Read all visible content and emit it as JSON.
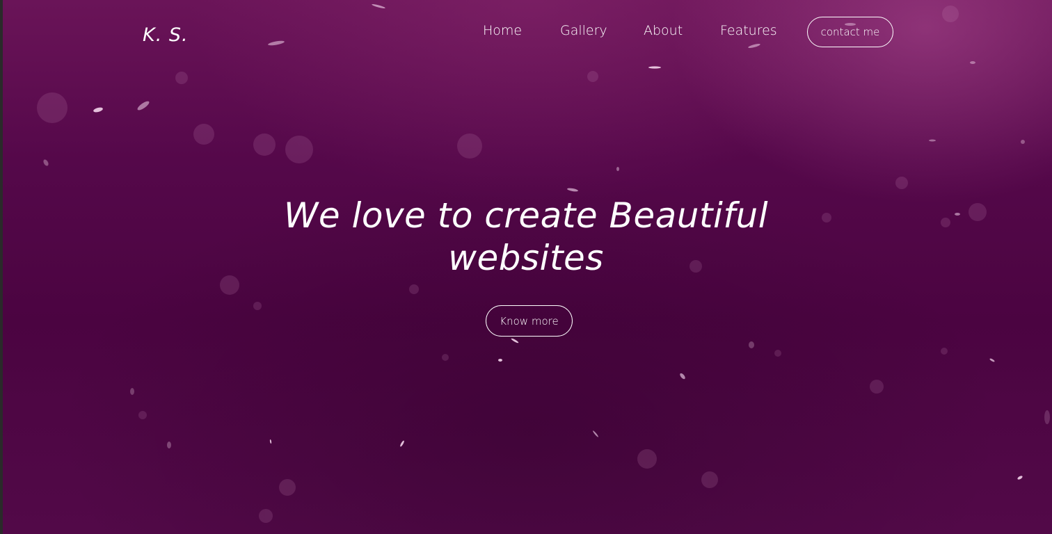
{
  "brand": {
    "logo": "K. S."
  },
  "nav": {
    "items": [
      {
        "label": "Home"
      },
      {
        "label": "Gallery"
      },
      {
        "label": "About"
      },
      {
        "label": "Features"
      }
    ],
    "contact_label": "contact me"
  },
  "hero": {
    "headline_part1": "We love to create",
    "headline_emphasis": "Beautiful",
    "headline_part2": "websites",
    "cta_label": "Know more"
  },
  "colors": {
    "background_top": "#6a1458",
    "background_mid": "#4b0441",
    "text": "#ffffff"
  }
}
